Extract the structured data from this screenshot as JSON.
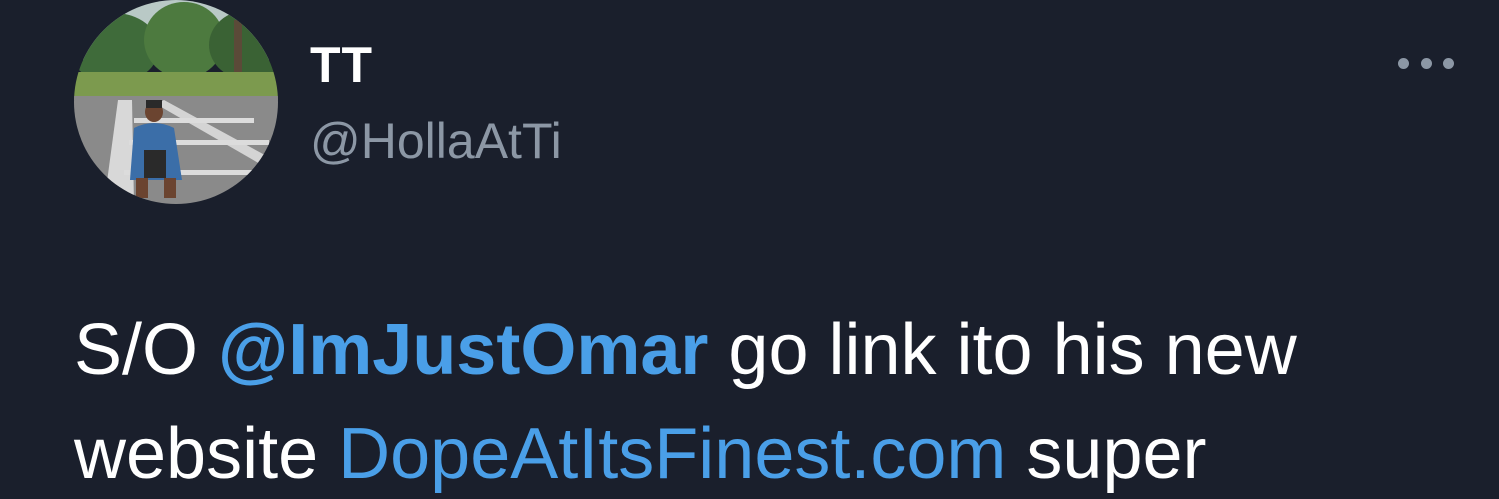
{
  "author": {
    "display_name": "TT",
    "handle": "@HollaAtTi"
  },
  "menu": {
    "icon": "more-horizontal-icon"
  },
  "tweet": {
    "prefix": "S/O ",
    "mention": "@ImJustOmar",
    "middle": " go link ito his new",
    "line2_prefix": "website ",
    "link": "DopeAtItsFinest.com",
    "suffix": " super"
  },
  "colors": {
    "background": "#1a1f2c",
    "text": "#ffffff",
    "secondary_text": "#8c97a5",
    "accent": "#4a9fe8"
  }
}
